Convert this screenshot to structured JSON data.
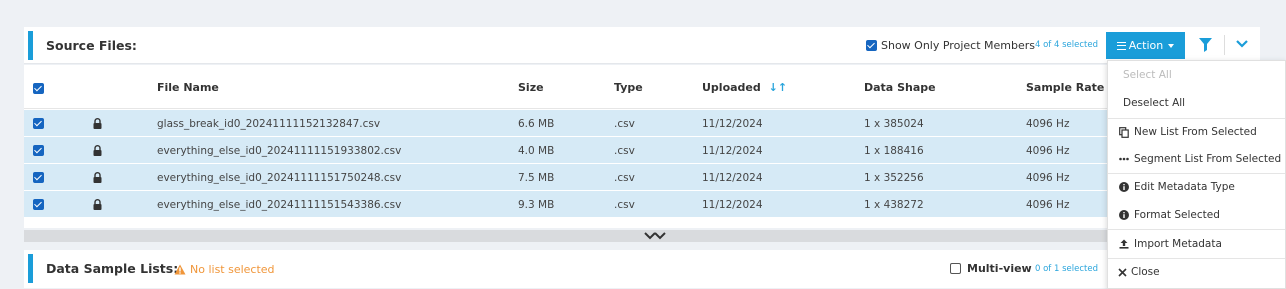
{
  "source_files": {
    "title": "Source Files:",
    "show_members_label": "Show Only Project Members",
    "selected_count": "4 of 4 selected",
    "action_label": "Action"
  },
  "table": {
    "columns": [
      "File Name",
      "Size",
      "Type",
      "Uploaded",
      "Data Shape",
      "Sample Rate"
    ],
    "sort_indicator": "↓↑",
    "rows": [
      {
        "file_name": "glass_break_id0_20241111152132847.csv",
        "size": "6.6 MB",
        "type": ".csv",
        "uploaded": "11/12/2024",
        "data_shape": "1 x 385024",
        "sample_rate": "4096 Hz"
      },
      {
        "file_name": "everything_else_id0_20241111151933802.csv",
        "size": "4.0 MB",
        "type": ".csv",
        "uploaded": "11/12/2024",
        "data_shape": "1 x 188416",
        "sample_rate": "4096 Hz"
      },
      {
        "file_name": "everything_else_id0_20241111151750248.csv",
        "size": "7.5 MB",
        "type": ".csv",
        "uploaded": "11/12/2024",
        "data_shape": "1 x 352256",
        "sample_rate": "4096 Hz"
      },
      {
        "file_name": "everything_else_id0_20241111151543386.csv",
        "size": "9.3 MB",
        "type": ".csv",
        "uploaded": "11/12/2024",
        "data_shape": "1 x 438272",
        "sample_rate": "4096 Hz"
      }
    ]
  },
  "data_sample_lists": {
    "title": "Data Sample Lists:",
    "no_list": "No list selected",
    "multiview_label": "Multi-view",
    "selected_count": "0 of 1 selected"
  },
  "action_menu": {
    "items": [
      {
        "label": "Select All",
        "icon": "none",
        "disabled": true
      },
      {
        "label": "Deselect All",
        "icon": "none",
        "disabled": false
      },
      {
        "label": "New List From Selected",
        "icon": "copy-icon",
        "disabled": false
      },
      {
        "label": "Segment List From Selected",
        "icon": "ellipsis-icon",
        "disabled": false
      },
      {
        "label": "Edit Metadata Type",
        "icon": "info-icon",
        "disabled": false
      },
      {
        "label": "Format Selected",
        "icon": "info-icon",
        "disabled": false
      },
      {
        "label": "Import Metadata",
        "icon": "upload-icon",
        "disabled": false
      },
      {
        "label": "Close",
        "icon": "close-icon",
        "disabled": false
      }
    ]
  },
  "colors": {
    "accent": "#1a9dd9",
    "row_selected": "#d6eaf6",
    "checkbox": "#1565c0",
    "warning": "#f0963a"
  }
}
